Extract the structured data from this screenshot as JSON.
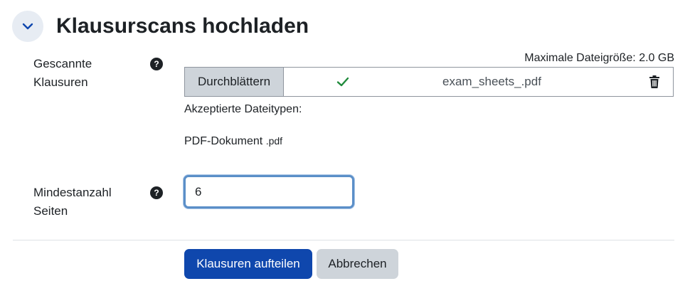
{
  "section": {
    "title": "Klausurscans hochladen",
    "collapse_icon": "chevron-down-icon"
  },
  "scans_field": {
    "label_line1": "Gescannte",
    "label_line2": "Klausuren",
    "help_glyph": "?",
    "max_size_label": "Maximale Dateigröße: 2.0 GB",
    "browse_label": "Durchblättern",
    "status_icon": "check-icon",
    "file_name": "exam_sheets_.pdf",
    "delete_icon": "trash-icon",
    "accepted_types_label": "Akzeptierte Dateitypen:",
    "accepted_type_name": "PDF-Dokument",
    "accepted_type_ext": ".pdf"
  },
  "pages_field": {
    "label_line1": "Mindestanzahl",
    "label_line2": "Seiten",
    "help_glyph": "?",
    "value": "6"
  },
  "actions": {
    "submit_label": "Klausuren aufteilen",
    "cancel_label": "Abbrechen"
  },
  "colors": {
    "primary": "#0f47ad",
    "secondary": "#ced4da",
    "success": "#1f8a3b",
    "focus_ring": "#5b8fc8",
    "collapse_bg": "#e7ecf3"
  }
}
